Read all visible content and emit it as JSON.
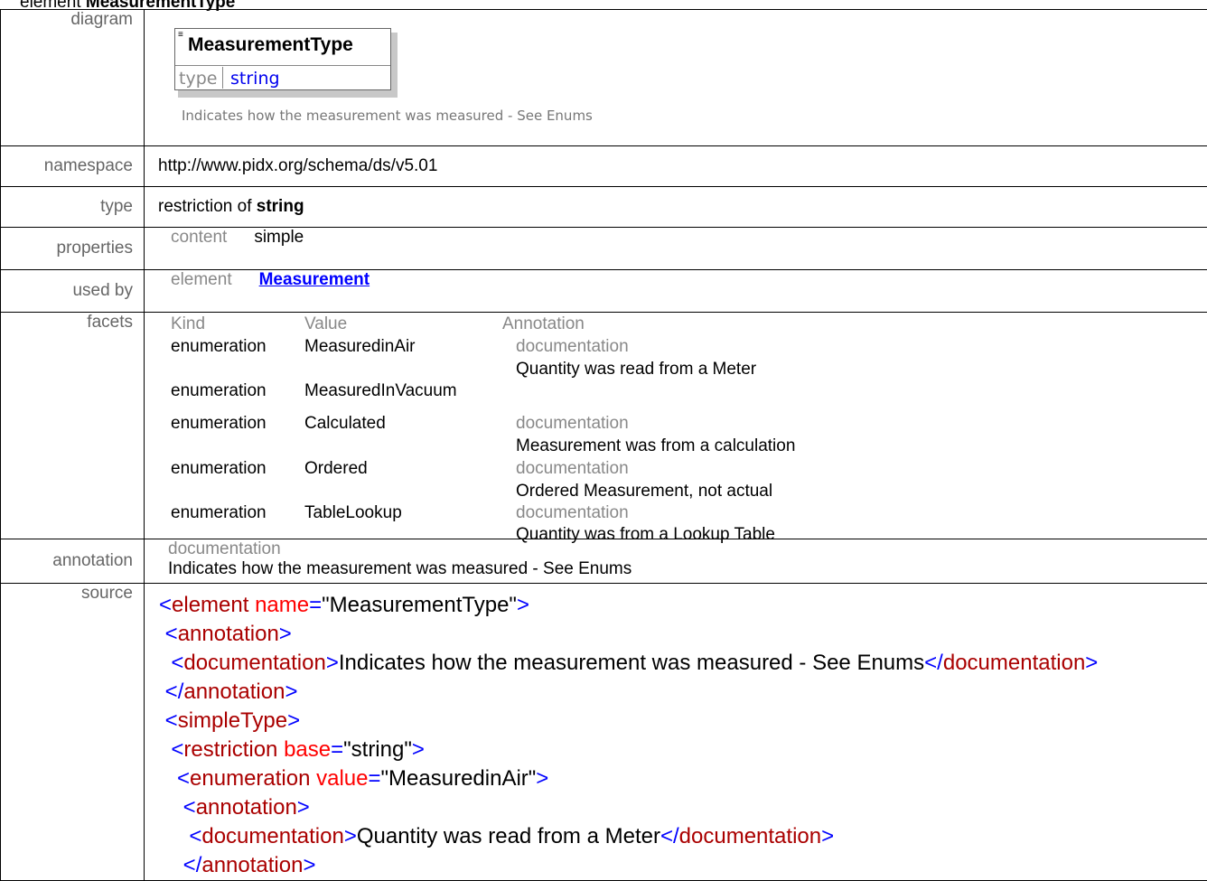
{
  "heading": {
    "prefix": "element",
    "name": "MeasurementType"
  },
  "labels": {
    "diagram": "diagram",
    "namespace": "namespace",
    "type": "type",
    "properties": "properties",
    "used_by": "used by",
    "facets": "facets",
    "annotation": "annotation",
    "source": "source"
  },
  "diagram": {
    "title": "MeasurementType",
    "type_label": "type",
    "type_value": "string",
    "caption": "Indicates how the measurement was measured - See Enums",
    "icon": "element-docs-icon"
  },
  "namespace": "http://www.pidx.org/schema/ds/v5.01",
  "type": {
    "prefix": "restriction of",
    "base": "string"
  },
  "properties": {
    "key": "content",
    "value": "simple"
  },
  "used_by": {
    "key": "element",
    "value": "Measurement"
  },
  "facets": {
    "headers": [
      "Kind",
      "Value",
      "Annotation"
    ],
    "rows": [
      {
        "kind": "enumeration",
        "value": "MeasuredinAir",
        "doc_label": "documentation",
        "doc": "Quantity was read from a Meter"
      },
      {
        "kind": "enumeration",
        "value": "MeasuredInVacuum",
        "doc_label": "",
        "doc": ""
      },
      {
        "kind": "enumeration",
        "value": "Calculated",
        "doc_label": "documentation",
        "doc": "Measurement was from a calculation"
      },
      {
        "kind": "enumeration",
        "value": "Ordered",
        "doc_label": "documentation",
        "doc": "Ordered Measurement, not actual"
      },
      {
        "kind": "enumeration",
        "value": "TableLookup",
        "doc_label": "documentation",
        "doc": "Quantity was from a Lookup Table"
      }
    ]
  },
  "annotation": {
    "label": "documentation",
    "text": "Indicates how the measurement was measured - See Enums"
  },
  "source": {
    "lines": [
      {
        "indent": 0,
        "open": "<",
        "tag": "element",
        "attr": "name",
        "eq": "=",
        "val": "\"MeasurementType\"",
        "close": ">",
        "text": "",
        "end": ""
      },
      {
        "indent": 1,
        "open": "<",
        "tag": "annotation",
        "attr": "",
        "eq": "",
        "val": "",
        "close": ">",
        "text": "",
        "end": ""
      },
      {
        "indent": 2,
        "open": "<",
        "tag": "documentation",
        "attr": "",
        "eq": "",
        "val": "",
        "close": ">",
        "text": "Indicates how the measurement was measured - See Enums",
        "end": "documentation"
      },
      {
        "indent": 1,
        "open": "</",
        "tag": "annotation",
        "attr": "",
        "eq": "",
        "val": "",
        "close": ">",
        "text": "",
        "end": ""
      },
      {
        "indent": 1,
        "open": "<",
        "tag": "simpleType",
        "attr": "",
        "eq": "",
        "val": "",
        "close": ">",
        "text": "",
        "end": ""
      },
      {
        "indent": 2,
        "open": "<",
        "tag": "restriction",
        "attr": "base",
        "eq": "=",
        "val": "\"string\"",
        "close": ">",
        "text": "",
        "end": ""
      },
      {
        "indent": 3,
        "open": "<",
        "tag": "enumeration",
        "attr": "value",
        "eq": "=",
        "val": "\"MeasuredinAir\"",
        "close": ">",
        "text": "",
        "end": ""
      },
      {
        "indent": 4,
        "open": "<",
        "tag": "annotation",
        "attr": "",
        "eq": "",
        "val": "",
        "close": ">",
        "text": "",
        "end": ""
      },
      {
        "indent": 5,
        "open": "<",
        "tag": "documentation",
        "attr": "",
        "eq": "",
        "val": "",
        "close": ">",
        "text": "Quantity was read from a Meter",
        "end": "documentation"
      },
      {
        "indent": 4,
        "open": "</",
        "tag": "annotation",
        "attr": "",
        "eq": "",
        "val": "",
        "close": ">",
        "text": "",
        "end": ""
      }
    ]
  }
}
